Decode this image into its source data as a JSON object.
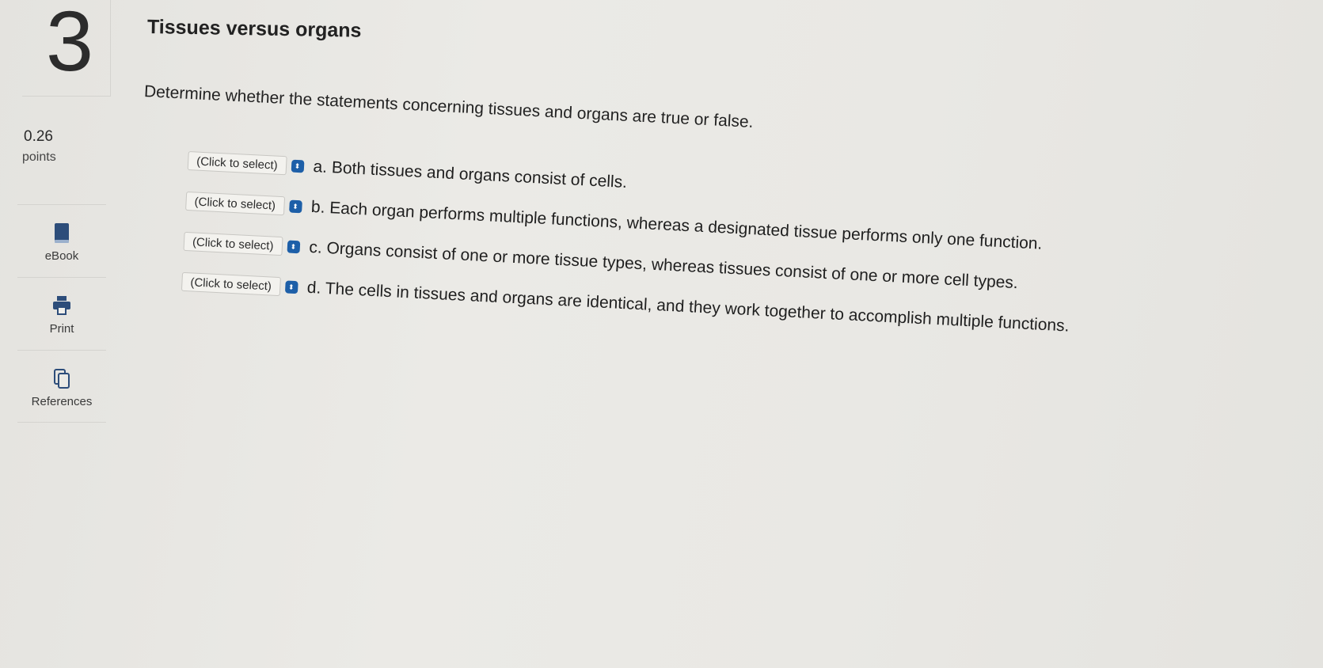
{
  "question": {
    "number": "3",
    "points_value": "0.26",
    "points_label": "points",
    "title": "Tissues versus organs",
    "instruction": "Determine whether the statements concerning tissues and organs are true or false."
  },
  "tools": [
    {
      "label": "eBook",
      "icon": "book-icon"
    },
    {
      "label": "Print",
      "icon": "printer-icon"
    },
    {
      "label": "References",
      "icon": "copy-icon"
    }
  ],
  "statements": [
    {
      "select_value": "(Click to select)",
      "text": "a. Both tissues and organs consist of cells."
    },
    {
      "select_value": "(Click to select)",
      "text": "b. Each organ performs multiple functions, whereas a designated tissue performs only one function."
    },
    {
      "select_value": "(Click to select)",
      "text": "c. Organs consist of one or more tissue types, whereas tissues consist of one or more cell types."
    },
    {
      "select_value": "(Click to select)",
      "text": "d. The cells in tissues and organs are identical, and they work together to accomplish multiple functions."
    }
  ],
  "colors": {
    "select_arrow": "#1d5fa8",
    "background": "#e9e8e4"
  }
}
